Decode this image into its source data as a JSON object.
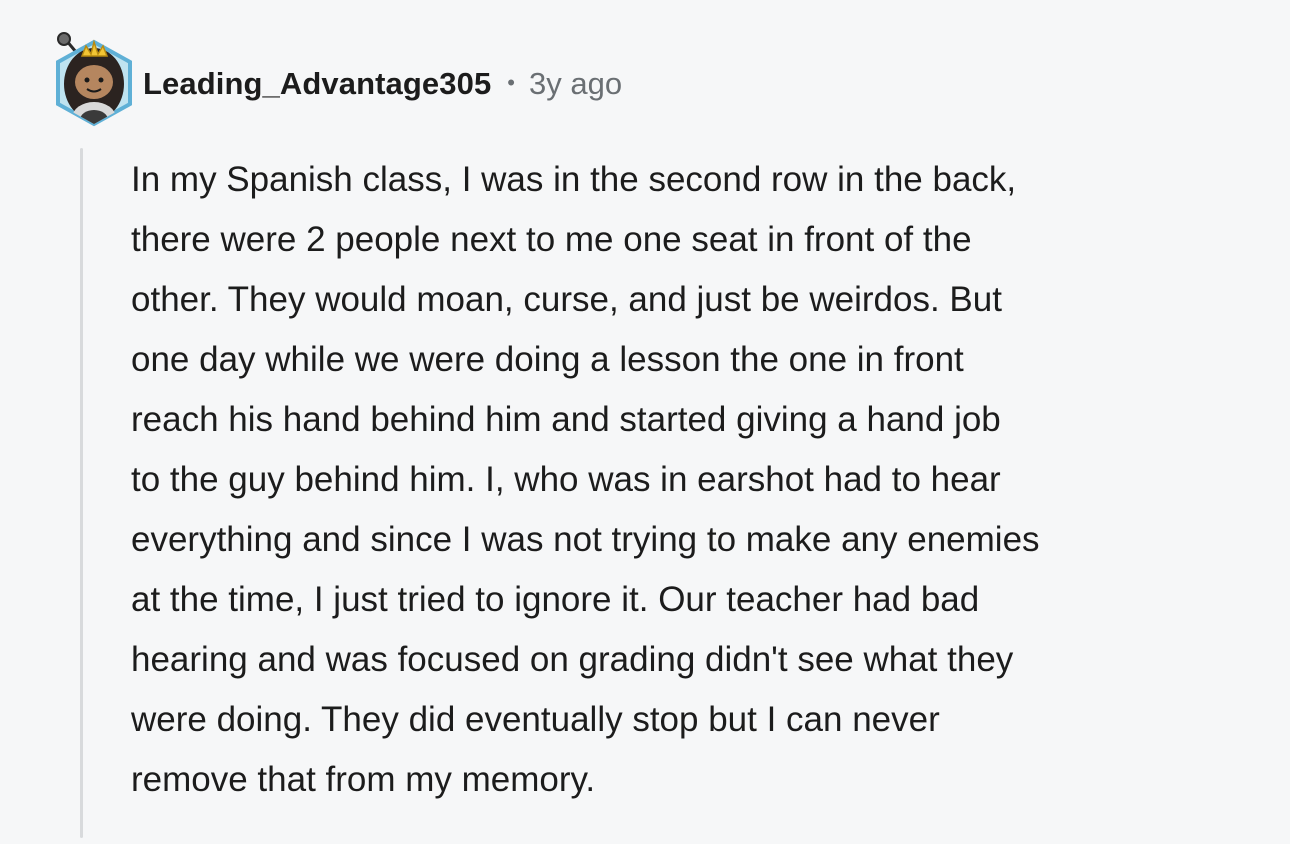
{
  "comment": {
    "username": "Leading_Advantage305",
    "separator": "•",
    "timestamp": "3y ago",
    "avatar_icon": "snoo-avatar-icon",
    "body_lines": [
      "In my Spanish class, I was in the second row in the back,",
      "there were 2 people next to me one seat in front of the",
      "other. They would moan, curse, and just be weirdos. But",
      "one day while we were doing a lesson the one in front",
      "reach his hand behind him and started giving a hand job",
      "to the guy behind him. I, who was in earshot had to hear",
      "everything and since I was not trying to make any enemies",
      "at the time, I just tried to ignore it. Our teacher had bad",
      "hearing and was focused on grading didn't see what they",
      "were doing. They did eventually stop but I can never",
      "remove that from my memory."
    ]
  },
  "colors": {
    "background": "#f6f7f8",
    "text": "#1c1c1c",
    "meta": "#6a6f73",
    "thread_line": "#d8dadc",
    "avatar_ring": "#5fb0d6"
  }
}
